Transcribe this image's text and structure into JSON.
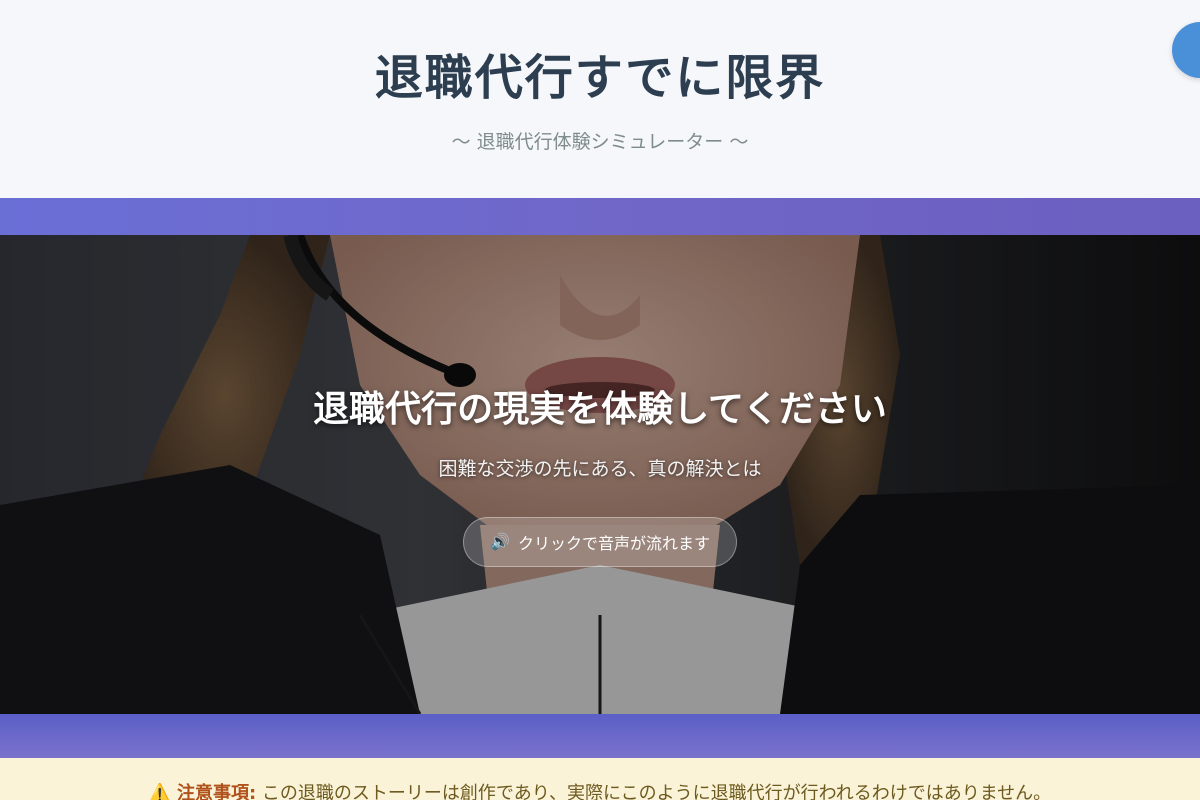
{
  "header": {
    "title": "退職代行すでに限界",
    "subtitle": "〜 退職代行体験シミュレーター 〜"
  },
  "hero": {
    "title": "退職代行の現実を体験してください",
    "subtitle": "困難な交渉の先にある、真の解決とは",
    "audio_button": {
      "icon": "🔊",
      "label": "クリックで音声が流れます"
    }
  },
  "notice": {
    "icon": "⚠️",
    "label": "注意事項:",
    "text": "この退職のストーリーは創作であり、実際にこのように退職代行が行われるわけではありません。"
  },
  "colors": {
    "title": "#2c3e50",
    "subtitle": "#7f8c8d",
    "band": "#6a6fd6",
    "notice_bg": "#fbf3d8",
    "notice_label": "#b0521b",
    "corner_button": "#4a90d9"
  }
}
